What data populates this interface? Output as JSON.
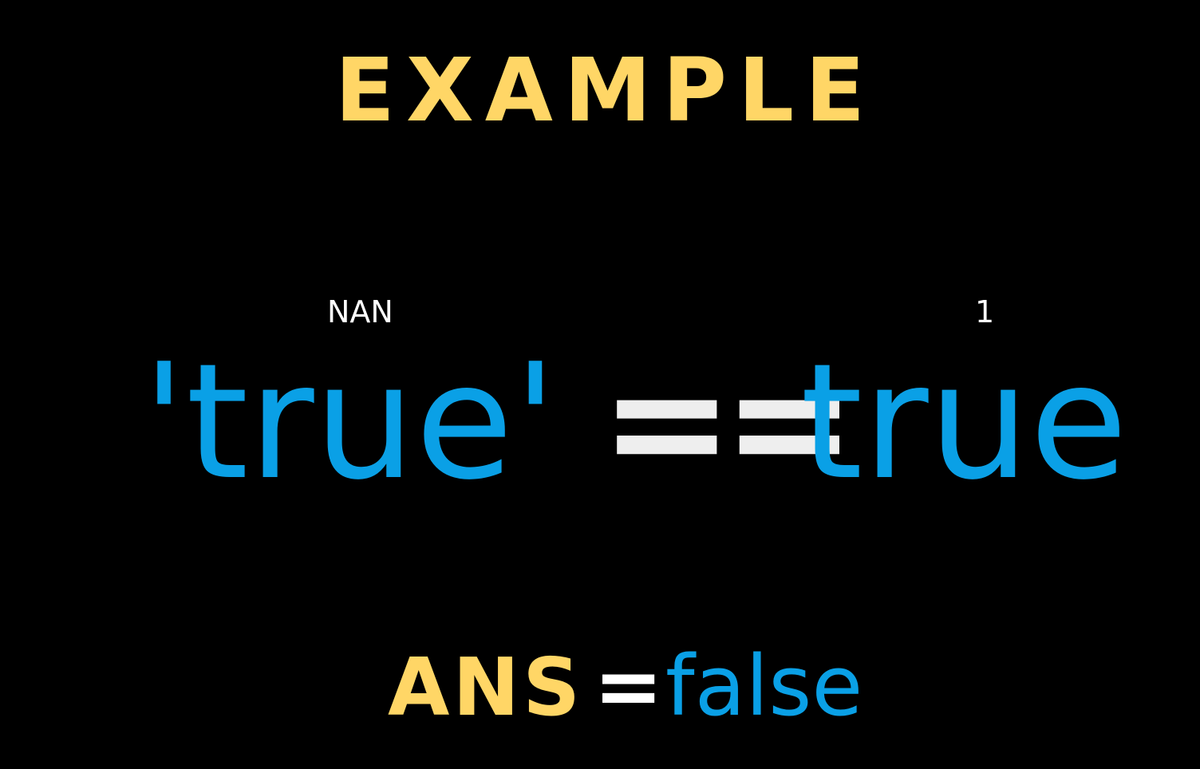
{
  "title": "EXAMPLE",
  "annotations": {
    "left": "NAN",
    "right": "1"
  },
  "expression": {
    "left_operand": "'true'",
    "operator": "==",
    "right_operand": "true"
  },
  "answer": {
    "label": "ANS",
    "equals": "=",
    "value": "false"
  },
  "colors": {
    "background": "#000000",
    "title": "#FFD666",
    "operand": "#0AA0E6",
    "operator": "#EEEEEE",
    "annotation": "#FFFFFF"
  }
}
